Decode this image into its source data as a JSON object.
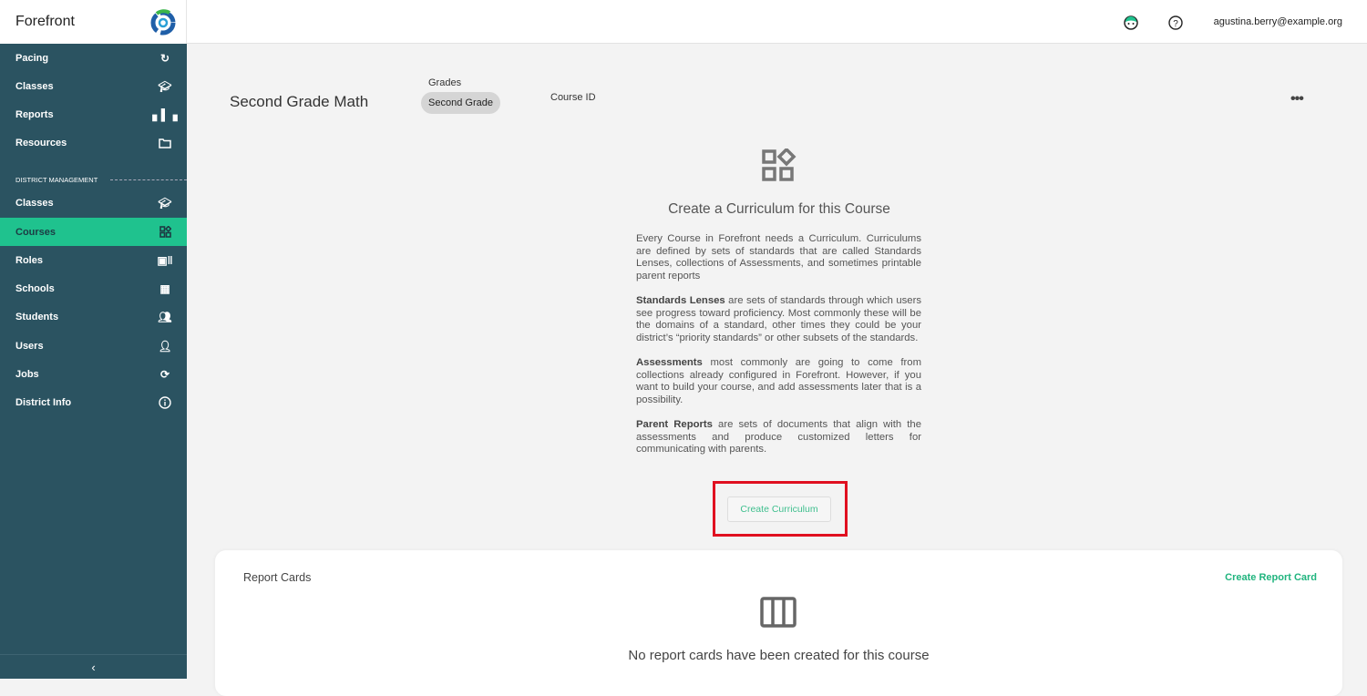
{
  "app": {
    "name": "Forefront"
  },
  "sidebar": {
    "items": [
      {
        "label": "Pacing",
        "icon": "pacing-icon"
      },
      {
        "label": "Classes",
        "icon": "graduation-cap-icon"
      },
      {
        "label": "Reports",
        "icon": "bar-chart-icon"
      },
      {
        "label": "Resources",
        "icon": "folder-icon"
      }
    ],
    "section_label": "DISTRICT MANAGEMENT",
    "district_items": [
      {
        "label": "Classes",
        "icon": "graduation-cap-icon"
      },
      {
        "label": "Courses",
        "icon": "widgets-icon",
        "active": true
      },
      {
        "label": "Roles",
        "icon": "badge-icon"
      },
      {
        "label": "Schools",
        "icon": "building-icon"
      },
      {
        "label": "Students",
        "icon": "people-icon"
      },
      {
        "label": "Users",
        "icon": "person-icon"
      },
      {
        "label": "Jobs",
        "icon": "sync-icon"
      },
      {
        "label": "District Info",
        "icon": "info-icon"
      }
    ]
  },
  "topbar": {
    "email": "agustina.berry@example.org"
  },
  "course": {
    "title": "Second Grade Math",
    "grades_label": "Grades",
    "grade": "Second Grade",
    "course_id_label": "Course ID"
  },
  "curriculum": {
    "title": "Create a Curriculum for this Course",
    "p1": "Every Course in Forefront needs a Curriculum. Curriculums are defined by sets of standards that are called Standards Lenses, collections of Assessments, and sometimes printable parent reports",
    "p2_bold": "Standards Lenses",
    "p2": " are sets of standards through which users see progress toward proficiency. Most commonly these will be the domains of a standard, other times they could be your district’s “priority standards” or other subsets of the standards.",
    "p3_bold": "Assessments",
    "p3": " most commonly are going to come from collections already configured in Forefront. However, if you want to build your course, and add assessments later that is a possibility.",
    "p4_bold": "Parent Reports",
    "p4": " are sets of documents that align with the assessments and produce customized letters for communicating with parents.",
    "button": "Create Curriculum"
  },
  "report_cards": {
    "title": "Report Cards",
    "create": "Create Report Card",
    "empty": "No report cards have been created for this course"
  },
  "colors": {
    "sidebar": "#2b5361",
    "active": "#1fc28e",
    "accent": "#20b47e",
    "highlight": "#e01020"
  }
}
